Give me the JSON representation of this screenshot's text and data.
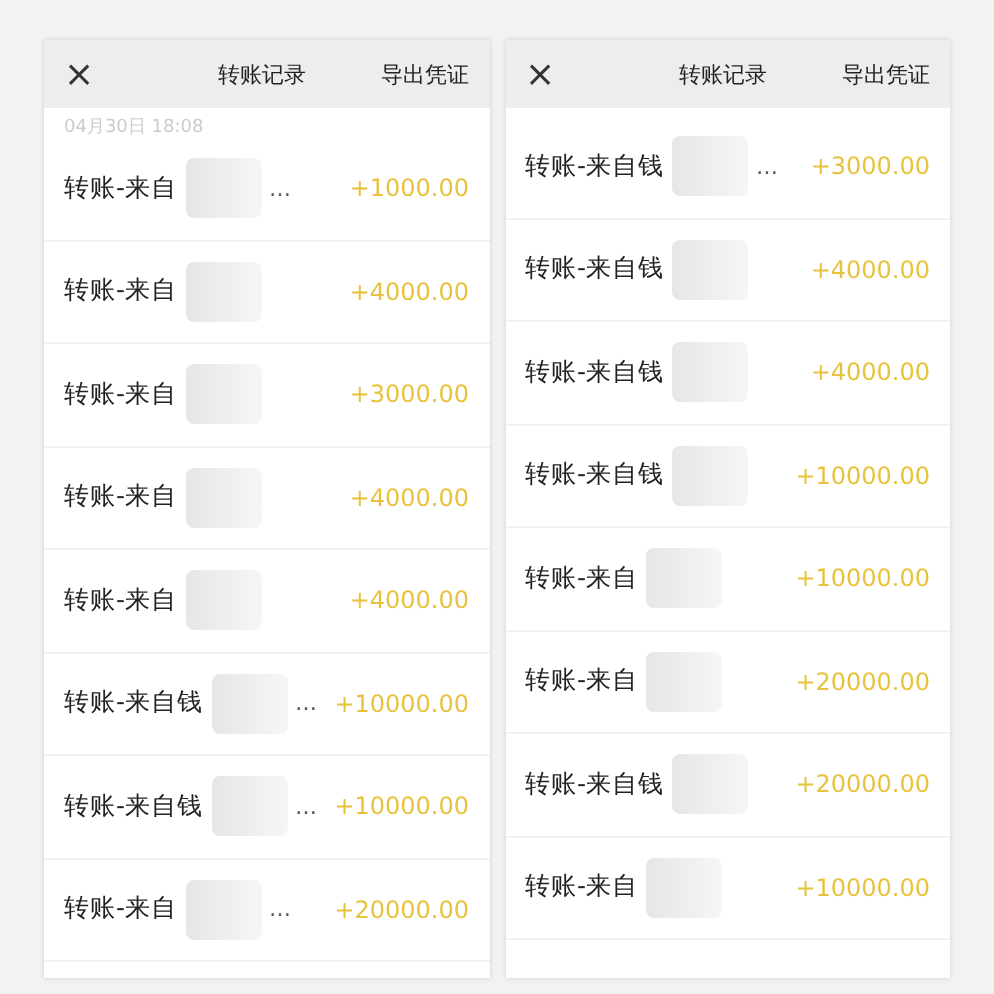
{
  "screens": [
    {
      "header": {
        "close": "×",
        "title": "转账记录",
        "action": "导出凭证"
      },
      "date": "04月30日 18:08",
      "rows": [
        {
          "title": "转账-来自",
          "ellipsis": "…",
          "amount": "+1000.00"
        },
        {
          "title": "转账-来自",
          "amount": "+4000.00"
        },
        {
          "title": "转账-来自",
          "amount": "+3000.00"
        },
        {
          "title": "转账-来自",
          "amount": "+4000.00"
        },
        {
          "title": "转账-来自",
          "amount": "+4000.00"
        },
        {
          "title": "转账-来自钱",
          "ellipsis": "…",
          "amount": "+10000.00"
        },
        {
          "title": "转账-来自钱",
          "ellipsis": "…",
          "amount": "+10000.00"
        },
        {
          "title": "转账-来自",
          "ellipsis": "…",
          "amount": "+20000.00"
        }
      ]
    },
    {
      "header": {
        "close": "×",
        "title": "转账记录",
        "action": "导出凭证"
      },
      "rows": [
        {
          "title": "转账-来自钱",
          "ellipsis": "…",
          "amount": "+3000.00"
        },
        {
          "title": "转账-来自钱",
          "amount": "+4000.00"
        },
        {
          "title": "转账-来自钱",
          "amount": "+4000.00"
        },
        {
          "title": "转账-来自钱",
          "amount": "+10000.00"
        },
        {
          "title": "转账-来自",
          "amount": "+10000.00"
        },
        {
          "title": "转账-来自",
          "amount": "+20000.00"
        },
        {
          "title": "转账-来自钱",
          "amount": "+20000.00"
        },
        {
          "title": "转账-来自",
          "amount": "+10000.00"
        }
      ]
    }
  ]
}
